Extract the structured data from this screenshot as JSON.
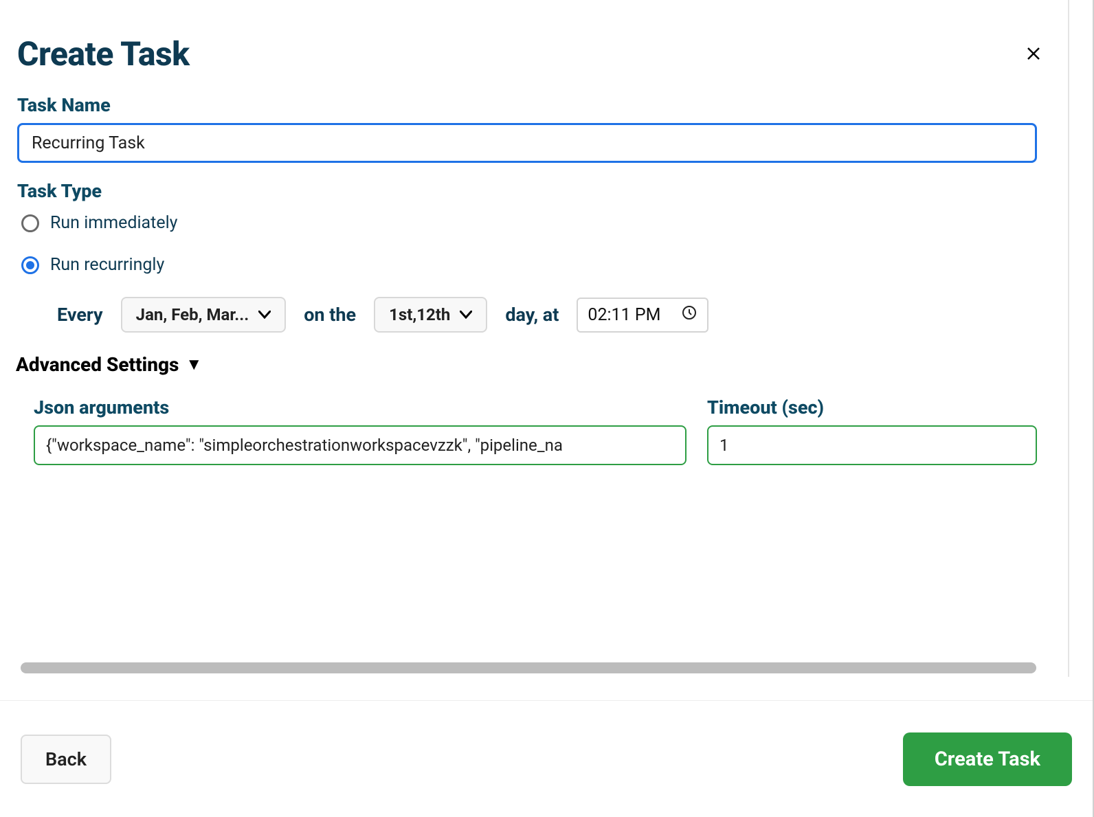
{
  "header": {
    "title": "Create Task"
  },
  "form": {
    "taskName": {
      "label": "Task Name",
      "value": "Recurring Task"
    },
    "taskType": {
      "label": "Task Type",
      "options": {
        "immediately": "Run immediately",
        "recurringly": "Run recurringly"
      },
      "selected": "recurringly"
    },
    "schedule": {
      "everyLabel": "Every",
      "monthsValue": "Jan, Feb, Mar...",
      "onTheLabel": "on the",
      "daysValue": "1st,12th",
      "dayAtLabel": "day, at",
      "timeValue": "02:11 PM"
    },
    "advanced": {
      "label": "Advanced Settings",
      "jsonArgs": {
        "label": "Json arguments",
        "value": "{\"workspace_name\": \"simpleorchestrationworkspacevzzk\", \"pipeline_na"
      },
      "timeout": {
        "label": "Timeout (sec)",
        "value": "1"
      }
    }
  },
  "footer": {
    "backLabel": "Back",
    "createLabel": "Create Task"
  }
}
